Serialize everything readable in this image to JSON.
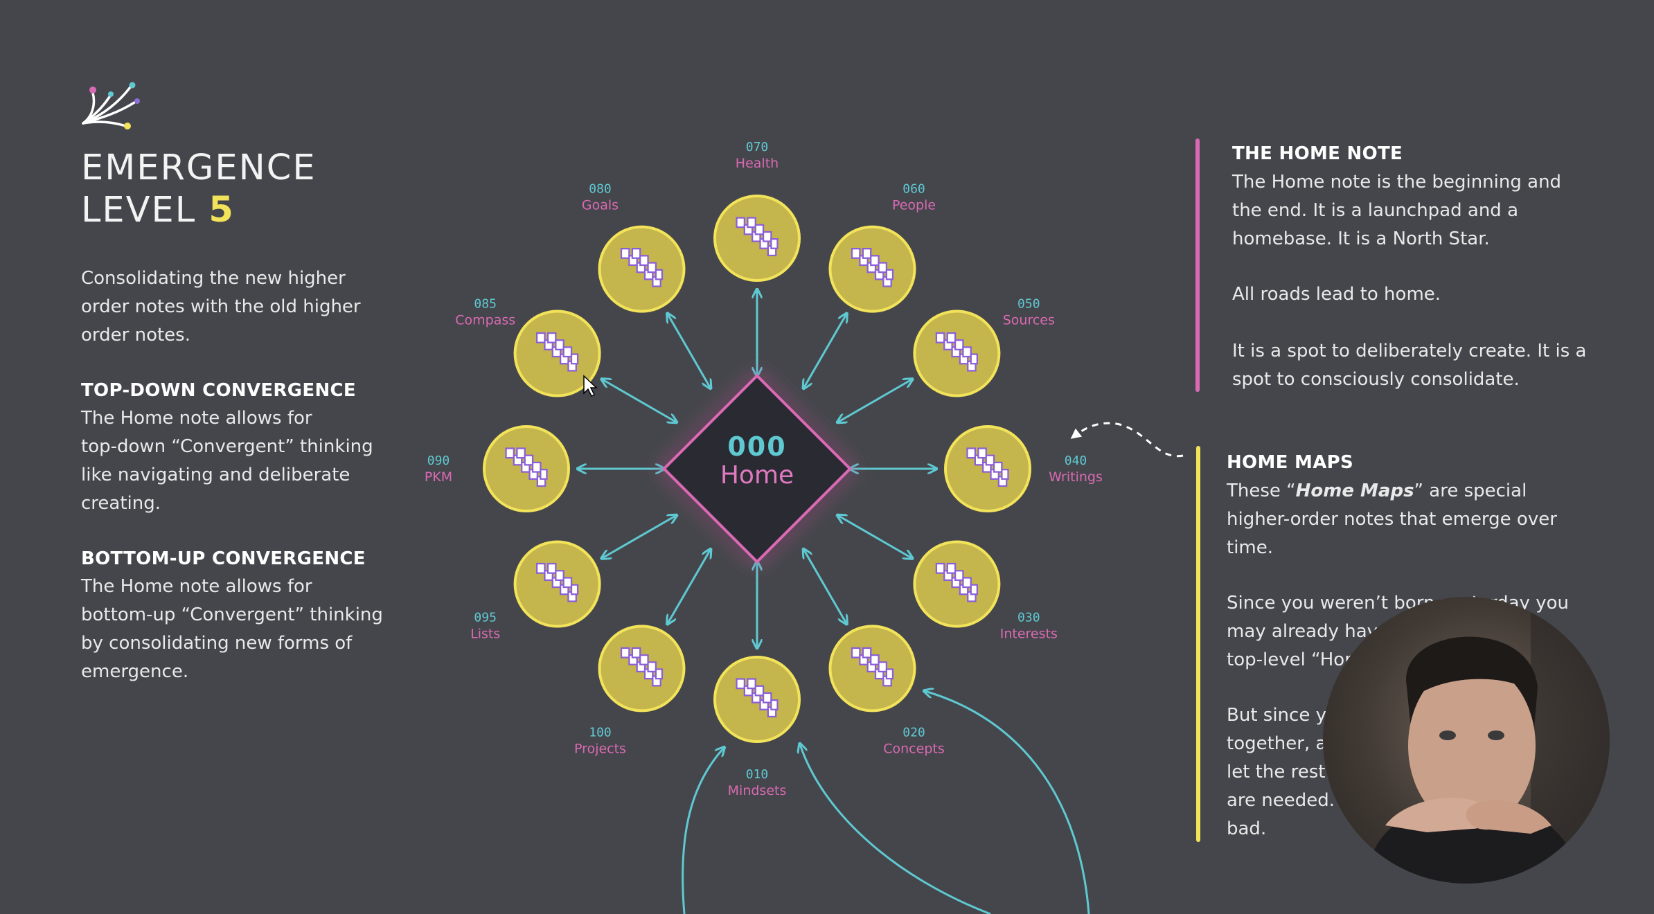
{
  "title": {
    "line1": "EMERGENCE",
    "line2": "LEVEL",
    "level": "5"
  },
  "left": {
    "intro": [
      "Consolidating the new higher",
      "order notes with the old higher",
      "order notes."
    ],
    "sections": [
      {
        "heading": "TOP-DOWN CONVERGENCE",
        "lines": [
          "The Home note allows for",
          "top-down “Convergent” thinking",
          "like navigating and deliberate",
          "creating."
        ]
      },
      {
        "heading": "BOTTOM-UP CONVERGENCE",
        "lines": [
          "The Home note allows for",
          "bottom-up “Convergent” thinking",
          "by consolidating new forms of",
          "emergence."
        ]
      }
    ]
  },
  "diagram": {
    "center": {
      "code": "000",
      "label": "Home"
    },
    "nodes": [
      {
        "code": "070",
        "label": "Health"
      },
      {
        "code": "060",
        "label": "People"
      },
      {
        "code": "050",
        "label": "Sources"
      },
      {
        "code": "040",
        "label": "Writings"
      },
      {
        "code": "030",
        "label": "Interests"
      },
      {
        "code": "020",
        "label": "Concepts"
      },
      {
        "code": "010",
        "label": "Mindsets"
      },
      {
        "code": "100",
        "label": "Projects"
      },
      {
        "code": "095",
        "label": "Lists"
      },
      {
        "code": "090",
        "label": "PKM"
      },
      {
        "code": "085",
        "label": "Compass"
      },
      {
        "code": "080",
        "label": "Goals"
      }
    ]
  },
  "right": {
    "home_note": {
      "heading": "THE HOME NOTE",
      "paragraphs": [
        [
          "The Home note is the beginning and",
          "the end. It is a launchpad and a",
          "homebase. It is a North Star."
        ],
        [
          "All roads lead to home."
        ],
        [
          "It is a spot to deliberately create. It is a",
          "spot to consciously consolidate."
        ]
      ]
    },
    "home_maps": {
      "heading": "HOME MAPS",
      "p1_prefix": "These “",
      "p1_em": "Home Maps",
      "p1_suffix": "” are special",
      "p1_lines": [
        "higher-order notes that emerge over",
        "time."
      ],
      "p2_lines": [
        "Since you weren’t born yesterday you",
        "may already have",
        "top-level “Hom"
      ],
      "p3_lines": [
        "But since yo",
        "together, ac",
        "let the rest e",
        "are needed. T",
        "bad."
      ]
    }
  },
  "colors": {
    "background": "#45464b",
    "accent_yellow": "#f2e35a",
    "accent_pink": "#d96ab3",
    "accent_cyan": "#5fc9d2",
    "node_fill": "#c4b64d",
    "center_fill": "#2b2b30"
  },
  "icons": [
    "emergence-logo-icon",
    "ladder-note-icon",
    "mouse-cursor-icon"
  ]
}
